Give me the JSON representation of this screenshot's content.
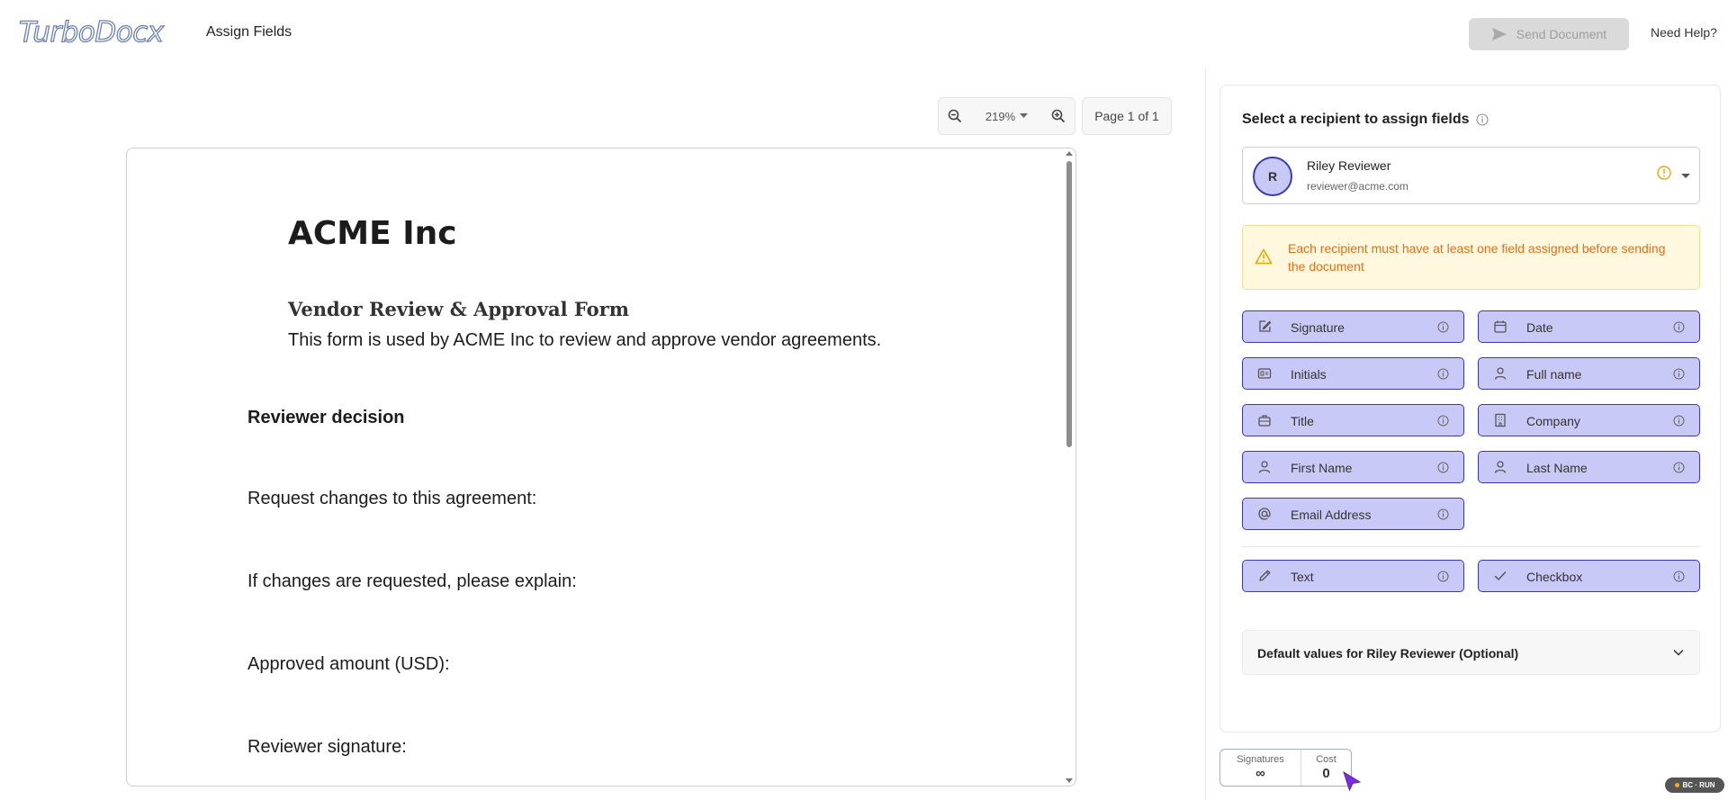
{
  "header": {
    "logo_main": "TurboDoc",
    "logo_x": "x",
    "page_title": "Assign Fields",
    "send_button": "Send Document",
    "help_link": "Need Help?"
  },
  "viewer": {
    "zoom": "219%",
    "page_indicator": "Page 1 of 1"
  },
  "document": {
    "company": "ACME Inc",
    "form_title": "Vendor Review & Approval Form",
    "description": "This form is used by ACME Inc to review and approve vendor agreements.",
    "section_heading": "Reviewer decision",
    "lines": [
      "Request changes to this agreement:",
      "If changes are requested, please explain:",
      "Approved amount (USD):",
      "Reviewer signature:"
    ]
  },
  "panel": {
    "heading": "Select a recipient to assign fields",
    "recipient": {
      "initial": "R",
      "name": "Riley Reviewer",
      "email": "reviewer@acme.com"
    },
    "warning": "Each recipient must have at least one field assigned before sending the document",
    "fields": [
      {
        "label": "Signature",
        "icon": "signature-icon"
      },
      {
        "label": "Date",
        "icon": "calendar-icon"
      },
      {
        "label": "Initials",
        "icon": "initials-icon"
      },
      {
        "label": "Full name",
        "icon": "user-icon"
      },
      {
        "label": "Title",
        "icon": "briefcase-icon"
      },
      {
        "label": "Company",
        "icon": "building-icon"
      },
      {
        "label": "First Name",
        "icon": "user-icon"
      },
      {
        "label": "Last Name",
        "icon": "user-icon"
      },
      {
        "label": "Email Address",
        "icon": "at-icon"
      },
      {
        "label": "Text",
        "icon": "pencil-icon"
      },
      {
        "label": "Checkbox",
        "icon": "check-icon"
      }
    ],
    "defaults_label": "Default values for Riley Reviewer (Optional)"
  },
  "stats": {
    "signatures_label": "Signatures",
    "signatures_value": "∞",
    "cost_label": "Cost",
    "cost_value": "0"
  },
  "badge_text": "BC · RUN",
  "colors": {
    "field_fill": "#c9c9f7",
    "field_border": "#3838b8",
    "warning_text": "#e0701a",
    "warning_bg": "#fff8df",
    "logo_stroke": "#6b7fb8"
  }
}
